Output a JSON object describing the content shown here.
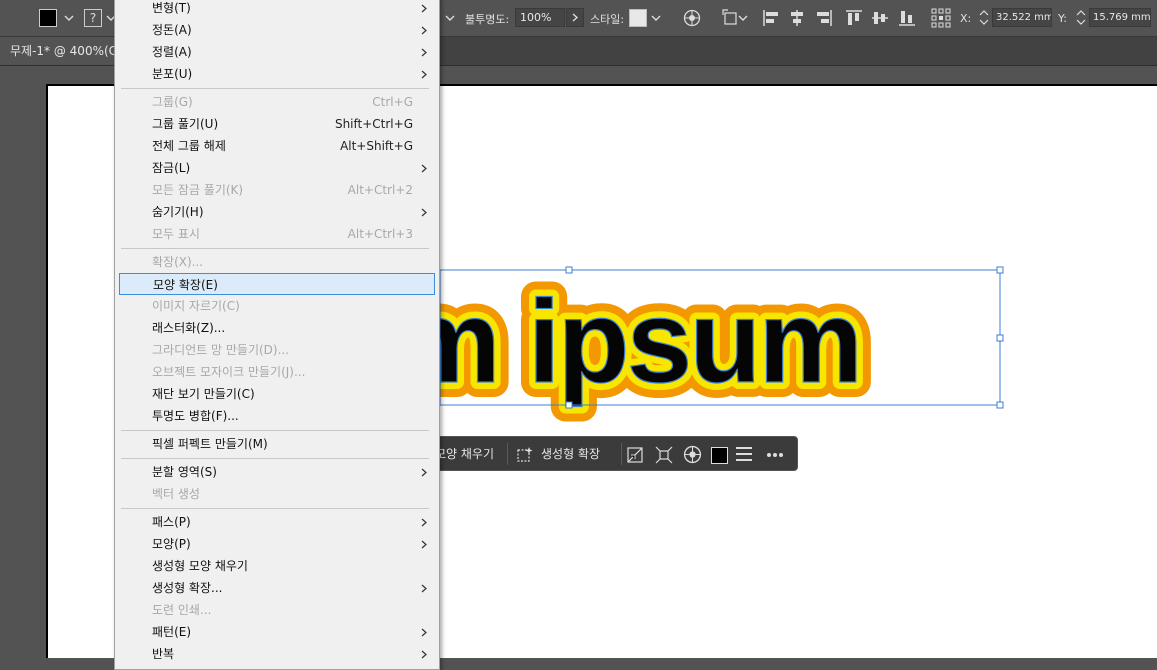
{
  "control_bar": {
    "opacity_label": "불투명도:",
    "opacity_value": "100%",
    "style_label": "스타일:",
    "x_label": "X:",
    "x_value": "32.522 mm",
    "y_label": "Y:",
    "y_value": "15.769 mm",
    "stroke_glyph": "?"
  },
  "document": {
    "tab_label": "무제-1* @ 400%(C"
  },
  "canvas": {
    "text": "m ipsum",
    "fill_color": "#050505",
    "inner_stroke_color": "#f7e600",
    "outer_stroke_color": "#f39800"
  },
  "taskbar": {
    "fill_label": "모양 채우기",
    "expand_label": "생성형 확장"
  },
  "menu": {
    "items": [
      {
        "label": "변형(T)",
        "shortcut": "",
        "submenu": true,
        "disabled": false
      },
      {
        "label": "정돈(A)",
        "shortcut": "",
        "submenu": true,
        "disabled": false
      },
      {
        "label": "정렬(A)",
        "shortcut": "",
        "submenu": true,
        "disabled": false
      },
      {
        "label": "분포(U)",
        "shortcut": "",
        "submenu": true,
        "disabled": false
      },
      {
        "label": "그룹(G)",
        "shortcut": "Ctrl+G",
        "submenu": false,
        "disabled": true
      },
      {
        "label": "그룹 풀기(U)",
        "shortcut": "Shift+Ctrl+G",
        "submenu": false,
        "disabled": false
      },
      {
        "label": "전체 그룹 해제",
        "shortcut": "Alt+Shift+G",
        "submenu": false,
        "disabled": false
      },
      {
        "label": "잠금(L)",
        "shortcut": "",
        "submenu": true,
        "disabled": false
      },
      {
        "label": "모든 잠금 풀기(K)",
        "shortcut": "Alt+Ctrl+2",
        "submenu": false,
        "disabled": true
      },
      {
        "label": "숨기기(H)",
        "shortcut": "",
        "submenu": true,
        "disabled": false
      },
      {
        "label": "모두 표시",
        "shortcut": "Alt+Ctrl+3",
        "submenu": false,
        "disabled": true
      },
      {
        "label": "확장(X)...",
        "shortcut": "",
        "submenu": false,
        "disabled": true
      },
      {
        "label": "모양 확장(E)",
        "shortcut": "",
        "submenu": false,
        "disabled": false,
        "active": true
      },
      {
        "label": "이미지 자르기(C)",
        "shortcut": "",
        "submenu": false,
        "disabled": true
      },
      {
        "label": "래스터화(Z)...",
        "shortcut": "",
        "submenu": false,
        "disabled": false
      },
      {
        "label": "그라디언트 망 만들기(D)...",
        "shortcut": "",
        "submenu": false,
        "disabled": true
      },
      {
        "label": "오브젝트 모자이크 만들기(J)...",
        "shortcut": "",
        "submenu": false,
        "disabled": true
      },
      {
        "label": "재단 보기 만들기(C)",
        "shortcut": "",
        "submenu": false,
        "disabled": false
      },
      {
        "label": "투명도 병합(F)...",
        "shortcut": "",
        "submenu": false,
        "disabled": false
      },
      {
        "label": "픽셀 퍼펙트 만들기(M)",
        "shortcut": "",
        "submenu": false,
        "disabled": false
      },
      {
        "label": "분할 영역(S)",
        "shortcut": "",
        "submenu": true,
        "disabled": false
      },
      {
        "label": "벡터 생성",
        "shortcut": "",
        "submenu": false,
        "disabled": true
      },
      {
        "label": "패스(P)",
        "shortcut": "",
        "submenu": true,
        "disabled": false
      },
      {
        "label": "모양(P)",
        "shortcut": "",
        "submenu": true,
        "disabled": false
      },
      {
        "label": "생성형 모양 채우기",
        "shortcut": "",
        "submenu": false,
        "disabled": false
      },
      {
        "label": "생성형 확장...",
        "shortcut": "",
        "submenu": true,
        "disabled": false
      },
      {
        "label": "도련 인쇄...",
        "shortcut": "",
        "submenu": false,
        "disabled": true
      },
      {
        "label": "패턴(E)",
        "shortcut": "",
        "submenu": true,
        "disabled": false
      },
      {
        "label": "반복",
        "shortcut": "",
        "submenu": true,
        "disabled": false
      }
    ]
  }
}
